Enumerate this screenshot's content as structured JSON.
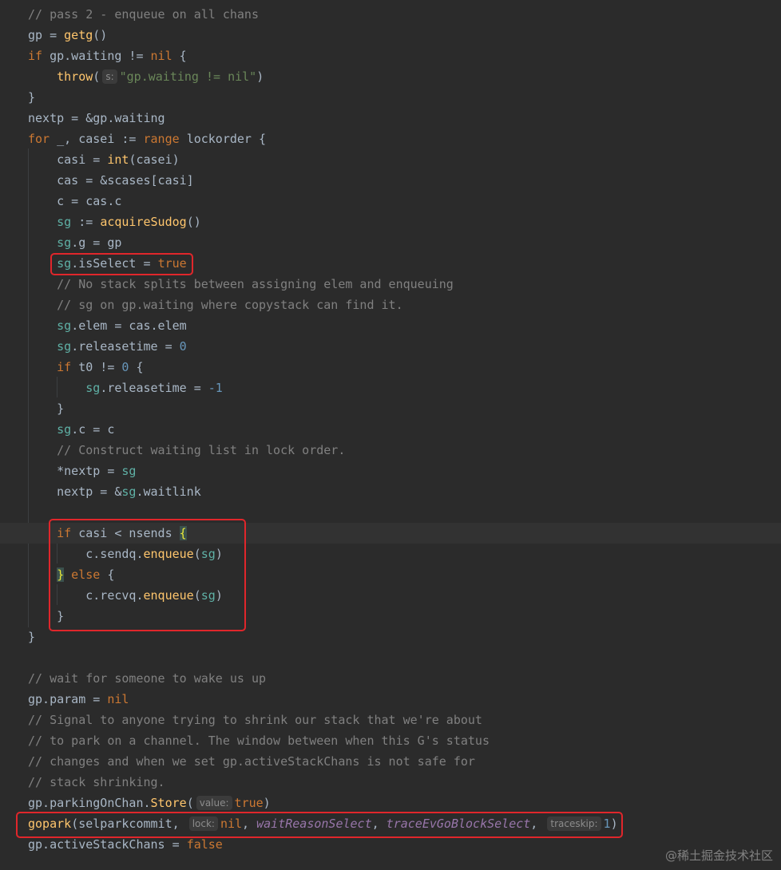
{
  "editor": {
    "theme_colors": {
      "background": "#2b2b2b",
      "keyword": "#cc7832",
      "function": "#ffc66d",
      "string": "#6a8759",
      "number": "#6897bb",
      "comment": "#808080",
      "field": "#9876aa",
      "highlight_box": "#e0262b"
    },
    "lines": [
      {
        "tokens": [
          {
            "t": "// pass 2 - enqueue on all chans",
            "c": "cmt"
          }
        ]
      },
      {
        "tokens": [
          {
            "t": "gp = ",
            "c": "plain"
          },
          {
            "t": "getg",
            "c": "fn"
          },
          {
            "t": "()",
            "c": "plain"
          }
        ]
      },
      {
        "tokens": [
          {
            "t": "if ",
            "c": "kw"
          },
          {
            "t": "gp.waiting != ",
            "c": "plain"
          },
          {
            "t": "nil",
            "c": "kw"
          },
          {
            "t": " {",
            "c": "plain"
          }
        ]
      },
      {
        "tokens": [
          {
            "t": "    ",
            "c": "plain"
          },
          {
            "t": "throw",
            "c": "fn"
          },
          {
            "t": "(",
            "c": "plain"
          },
          {
            "t": "s:",
            "c": "hint"
          },
          {
            "t": "\"gp.waiting != nil\"",
            "c": "str"
          },
          {
            "t": ")",
            "c": "plain"
          }
        ]
      },
      {
        "tokens": [
          {
            "t": "}",
            "c": "plain"
          }
        ]
      },
      {
        "tokens": [
          {
            "t": "nextp = &gp.waiting",
            "c": "plain"
          }
        ]
      },
      {
        "tokens": [
          {
            "t": "for ",
            "c": "kw"
          },
          {
            "t": "_, casei := ",
            "c": "plain"
          },
          {
            "t": "range ",
            "c": "kw"
          },
          {
            "t": "lockorder {",
            "c": "plain"
          }
        ]
      },
      {
        "tokens": [
          {
            "t": "    casi = ",
            "c": "plain"
          },
          {
            "t": "int",
            "c": "fn"
          },
          {
            "t": "(casei)",
            "c": "plain"
          }
        ]
      },
      {
        "tokens": [
          {
            "t": "    cas = &scases[casi]",
            "c": "plain"
          }
        ]
      },
      {
        "tokens": [
          {
            "t": "    c = cas.c",
            "c": "plain"
          }
        ]
      },
      {
        "tokens": [
          {
            "t": "    ",
            "c": "plain"
          },
          {
            "t": "sg",
            "c": "var"
          },
          {
            "t": " := ",
            "c": "plain"
          },
          {
            "t": "acquireSudog",
            "c": "fn"
          },
          {
            "t": "()",
            "c": "plain"
          }
        ]
      },
      {
        "tokens": [
          {
            "t": "    ",
            "c": "plain"
          },
          {
            "t": "sg",
            "c": "var"
          },
          {
            "t": ".g = gp",
            "c": "plain"
          }
        ]
      },
      {
        "tokens": [
          {
            "t": "    ",
            "c": "plain"
          },
          {
            "t": "sg",
            "c": "var"
          },
          {
            "t": ".isSelect = ",
            "c": "plain"
          },
          {
            "t": "true",
            "c": "kw"
          }
        ]
      },
      {
        "tokens": [
          {
            "t": "    // No stack splits between assigning elem and enqueuing",
            "c": "cmt"
          }
        ]
      },
      {
        "tokens": [
          {
            "t": "    // sg on gp.waiting where copystack can find it.",
            "c": "cmt"
          }
        ]
      },
      {
        "tokens": [
          {
            "t": "    ",
            "c": "plain"
          },
          {
            "t": "sg",
            "c": "var"
          },
          {
            "t": ".elem = cas.elem",
            "c": "plain"
          }
        ]
      },
      {
        "tokens": [
          {
            "t": "    ",
            "c": "plain"
          },
          {
            "t": "sg",
            "c": "var"
          },
          {
            "t": ".releasetime = ",
            "c": "plain"
          },
          {
            "t": "0",
            "c": "num"
          }
        ]
      },
      {
        "tokens": [
          {
            "t": "    ",
            "c": "plain"
          },
          {
            "t": "if ",
            "c": "kw"
          },
          {
            "t": "t0 != ",
            "c": "plain"
          },
          {
            "t": "0",
            "c": "num"
          },
          {
            "t": " {",
            "c": "plain"
          }
        ]
      },
      {
        "tokens": [
          {
            "t": "        ",
            "c": "plain"
          },
          {
            "t": "sg",
            "c": "var"
          },
          {
            "t": ".releasetime = ",
            "c": "plain"
          },
          {
            "t": "-1",
            "c": "num"
          }
        ]
      },
      {
        "tokens": [
          {
            "t": "    }",
            "c": "plain"
          }
        ]
      },
      {
        "tokens": [
          {
            "t": "    ",
            "c": "plain"
          },
          {
            "t": "sg",
            "c": "var"
          },
          {
            "t": ".c = c",
            "c": "plain"
          }
        ]
      },
      {
        "tokens": [
          {
            "t": "    // Construct waiting list in lock order.",
            "c": "cmt"
          }
        ]
      },
      {
        "tokens": [
          {
            "t": "    *nextp = ",
            "c": "plain"
          },
          {
            "t": "sg",
            "c": "var"
          }
        ]
      },
      {
        "tokens": [
          {
            "t": "    nextp = &",
            "c": "plain"
          },
          {
            "t": "sg",
            "c": "var"
          },
          {
            "t": ".waitlink",
            "c": "plain"
          }
        ]
      },
      {
        "tokens": []
      },
      {
        "current": true,
        "tokens": [
          {
            "t": "    ",
            "c": "plain"
          },
          {
            "t": "if ",
            "c": "kw"
          },
          {
            "t": "casi < nsends ",
            "c": "plain"
          },
          {
            "t": "{",
            "c": "bracket"
          }
        ]
      },
      {
        "tokens": [
          {
            "t": "        c.sendq.",
            "c": "plain"
          },
          {
            "t": "enqueue",
            "c": "fn"
          },
          {
            "t": "(",
            "c": "plain"
          },
          {
            "t": "sg",
            "c": "var"
          },
          {
            "t": ")",
            "c": "plain"
          }
        ]
      },
      {
        "tokens": [
          {
            "t": "    ",
            "c": "plain"
          },
          {
            "t": "}",
            "c": "bracket"
          },
          {
            "t": " else ",
            "c": "kw"
          },
          {
            "t": "{",
            "c": "plain"
          }
        ]
      },
      {
        "tokens": [
          {
            "t": "        c.recvq.",
            "c": "plain"
          },
          {
            "t": "enqueue",
            "c": "fn"
          },
          {
            "t": "(",
            "c": "plain"
          },
          {
            "t": "sg",
            "c": "var"
          },
          {
            "t": ")",
            "c": "plain"
          }
        ]
      },
      {
        "tokens": [
          {
            "t": "    }",
            "c": "plain"
          }
        ]
      },
      {
        "tokens": [
          {
            "t": "}",
            "c": "plain"
          }
        ]
      },
      {
        "tokens": []
      },
      {
        "tokens": [
          {
            "t": "// wait for someone to wake us up",
            "c": "cmt"
          }
        ]
      },
      {
        "tokens": [
          {
            "t": "gp.param = ",
            "c": "plain"
          },
          {
            "t": "nil",
            "c": "kw"
          }
        ]
      },
      {
        "tokens": [
          {
            "t": "// Signal to anyone trying to shrink our stack that we're about",
            "c": "cmt"
          }
        ]
      },
      {
        "tokens": [
          {
            "t": "// to park on a channel. The window between when this G's status",
            "c": "cmt"
          }
        ]
      },
      {
        "tokens": [
          {
            "t": "// changes and when we set gp.activeStackChans is not safe for",
            "c": "cmt"
          }
        ]
      },
      {
        "tokens": [
          {
            "t": "// stack shrinking.",
            "c": "cmt"
          }
        ]
      },
      {
        "tokens": [
          {
            "t": "gp.parkingOnChan.",
            "c": "plain"
          },
          {
            "t": "Store",
            "c": "fn"
          },
          {
            "t": "(",
            "c": "plain"
          },
          {
            "t": "value:",
            "c": "hint"
          },
          {
            "t": "true",
            "c": "kw"
          },
          {
            "t": ")",
            "c": "plain"
          }
        ]
      },
      {
        "tokens": [
          {
            "t": "gopark",
            "c": "fn"
          },
          {
            "t": "(selparkcommit, ",
            "c": "plain"
          },
          {
            "t": "lock:",
            "c": "hint"
          },
          {
            "t": "nil",
            "c": "kw"
          },
          {
            "t": ", ",
            "c": "plain"
          },
          {
            "t": "waitReasonSelect",
            "c": "italic"
          },
          {
            "t": ", ",
            "c": "plain"
          },
          {
            "t": "traceEvGoBlockSelect",
            "c": "italic"
          },
          {
            "t": ", ",
            "c": "plain"
          },
          {
            "t": "traceskip:",
            "c": "hint"
          },
          {
            "t": "1",
            "c": "num"
          },
          {
            "t": ")",
            "c": "plain"
          }
        ]
      },
      {
        "tokens": [
          {
            "t": "gp.activeStackChans = ",
            "c": "plain"
          },
          {
            "t": "false",
            "c": "kw"
          }
        ]
      }
    ]
  },
  "watermark": "@稀土掘金技术社区"
}
